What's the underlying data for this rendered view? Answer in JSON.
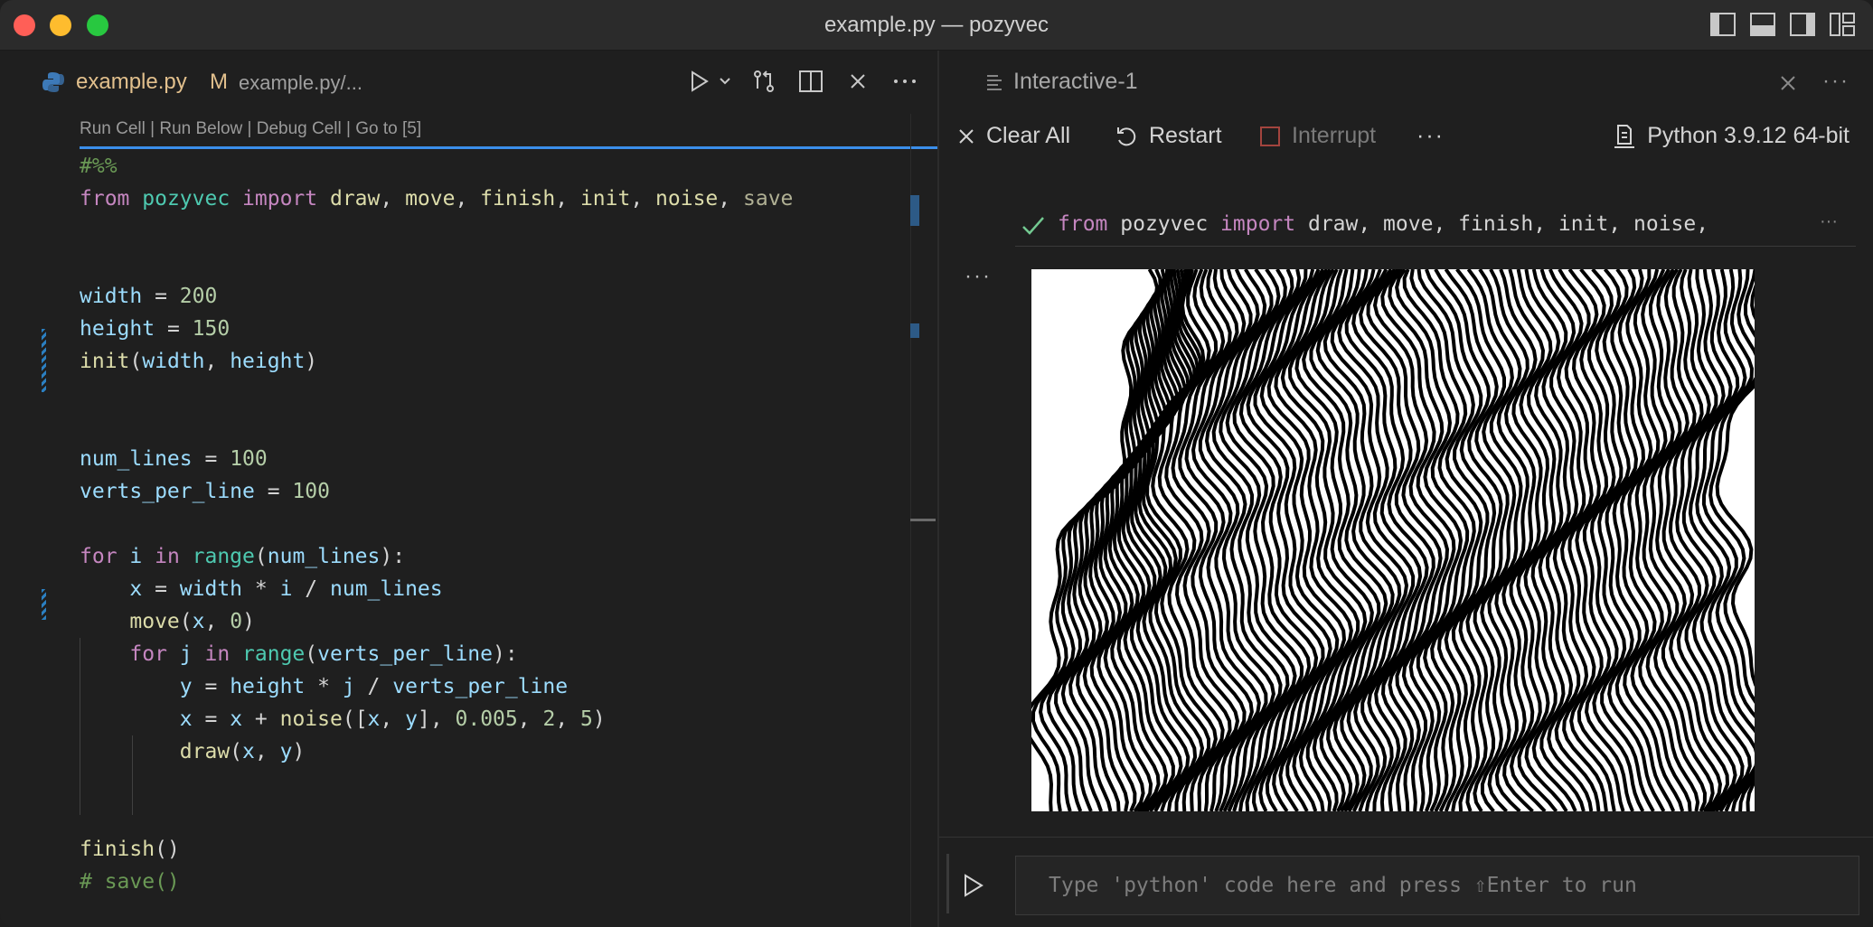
{
  "window": {
    "title": "example.py — pozyvec"
  },
  "editor": {
    "tab": {
      "filename": "example.py",
      "modified": "M",
      "path": "example.py/..."
    },
    "codelens": "Run Cell | Run Below | Debug Cell | Go to [5]",
    "lines": [
      {
        "tokens": [
          [
            "cm",
            "#%%"
          ]
        ]
      },
      {
        "tokens": [
          [
            "kw",
            "from "
          ],
          [
            "mod",
            "pozyvec "
          ],
          [
            "kw",
            "import "
          ],
          [
            "fn",
            "draw"
          ],
          [
            "pl",
            ", "
          ],
          [
            "fn",
            "move"
          ],
          [
            "pl",
            ", "
          ],
          [
            "fn",
            "finish"
          ],
          [
            "pl",
            ", "
          ],
          [
            "fn",
            "init"
          ],
          [
            "pl",
            ", "
          ],
          [
            "fn",
            "noise"
          ],
          [
            "pl",
            ", "
          ],
          [
            "dim",
            "save"
          ]
        ]
      },
      {
        "tokens": []
      },
      {
        "tokens": []
      },
      {
        "tokens": [
          [
            "var",
            "width "
          ],
          [
            "pl",
            "= "
          ],
          [
            "num",
            "200"
          ]
        ]
      },
      {
        "tokens": [
          [
            "var",
            "height "
          ],
          [
            "pl",
            "= "
          ],
          [
            "num",
            "150"
          ]
        ]
      },
      {
        "tokens": [
          [
            "fn",
            "init"
          ],
          [
            "pl",
            "("
          ],
          [
            "var",
            "width"
          ],
          [
            "pl",
            ", "
          ],
          [
            "var",
            "height"
          ],
          [
            "pl",
            ")"
          ]
        ]
      },
      {
        "tokens": []
      },
      {
        "tokens": []
      },
      {
        "tokens": [
          [
            "var",
            "num_lines "
          ],
          [
            "pl",
            "= "
          ],
          [
            "num",
            "100"
          ]
        ]
      },
      {
        "tokens": [
          [
            "var",
            "verts_per_line "
          ],
          [
            "pl",
            "= "
          ],
          [
            "num",
            "100"
          ]
        ]
      },
      {
        "tokens": []
      },
      {
        "tokens": [
          [
            "kw",
            "for "
          ],
          [
            "var",
            "i "
          ],
          [
            "kw",
            "in "
          ],
          [
            "mod",
            "range"
          ],
          [
            "pl",
            "("
          ],
          [
            "var",
            "num_lines"
          ],
          [
            "pl",
            "):"
          ]
        ]
      },
      {
        "tokens": [
          [
            "pl",
            "    "
          ],
          [
            "var",
            "x "
          ],
          [
            "pl",
            "= "
          ],
          [
            "var",
            "width "
          ],
          [
            "pl",
            "* "
          ],
          [
            "var",
            "i "
          ],
          [
            "pl",
            "/ "
          ],
          [
            "var",
            "num_lines"
          ]
        ]
      },
      {
        "tokens": [
          [
            "pl",
            "    "
          ],
          [
            "fn",
            "move"
          ],
          [
            "pl",
            "("
          ],
          [
            "var",
            "x"
          ],
          [
            "pl",
            ", "
          ],
          [
            "num",
            "0"
          ],
          [
            "pl",
            ")"
          ]
        ]
      },
      {
        "tokens": [
          [
            "pl",
            "    "
          ],
          [
            "kw",
            "for "
          ],
          [
            "var",
            "j "
          ],
          [
            "kw",
            "in "
          ],
          [
            "mod",
            "range"
          ],
          [
            "pl",
            "("
          ],
          [
            "var",
            "verts_per_line"
          ],
          [
            "pl",
            "):"
          ]
        ]
      },
      {
        "tokens": [
          [
            "pl",
            "        "
          ],
          [
            "var",
            "y "
          ],
          [
            "pl",
            "= "
          ],
          [
            "var",
            "height "
          ],
          [
            "pl",
            "* "
          ],
          [
            "var",
            "j "
          ],
          [
            "pl",
            "/ "
          ],
          [
            "var",
            "verts_per_line"
          ]
        ]
      },
      {
        "tokens": [
          [
            "pl",
            "        "
          ],
          [
            "var",
            "x "
          ],
          [
            "pl",
            "= "
          ],
          [
            "var",
            "x "
          ],
          [
            "pl",
            "+ "
          ],
          [
            "fn",
            "noise"
          ],
          [
            "pl",
            "(["
          ],
          [
            "var",
            "x"
          ],
          [
            "pl",
            ", "
          ],
          [
            "var",
            "y"
          ],
          [
            "pl",
            "], "
          ],
          [
            "num",
            "0.005"
          ],
          [
            "pl",
            ", "
          ],
          [
            "num",
            "2"
          ],
          [
            "pl",
            ", "
          ],
          [
            "num",
            "5"
          ],
          [
            "pl",
            ")"
          ]
        ]
      },
      {
        "tokens": [
          [
            "pl",
            "        "
          ],
          [
            "fn",
            "draw"
          ],
          [
            "pl",
            "("
          ],
          [
            "var",
            "x"
          ],
          [
            "pl",
            ", "
          ],
          [
            "var",
            "y"
          ],
          [
            "pl",
            ")"
          ]
        ]
      },
      {
        "tokens": []
      },
      {
        "tokens": []
      },
      {
        "tokens": [
          [
            "fn",
            "finish"
          ],
          [
            "pl",
            "()"
          ]
        ]
      },
      {
        "tokens": [
          [
            "cm",
            "# save()"
          ]
        ]
      }
    ]
  },
  "interactive": {
    "tab_title": "Interactive-1",
    "toolbar": {
      "clear_all": "Clear All",
      "restart": "Restart",
      "interrupt": "Interrupt",
      "more": "···",
      "kernel": "Python 3.9.12 64-bit"
    },
    "cell": {
      "tokens": [
        [
          "kw",
          "from "
        ],
        [
          "pl",
          "pozyvec "
        ],
        [
          "kw",
          "import "
        ],
        [
          "pl",
          "draw, move, finish, init, noise,"
        ]
      ]
    },
    "input_placeholder": "Type 'python' code here and press ⇧Enter to run"
  },
  "colors": {
    "accent": "#3b8eea",
    "check": "#73c991",
    "modified": "#e2c08d"
  }
}
